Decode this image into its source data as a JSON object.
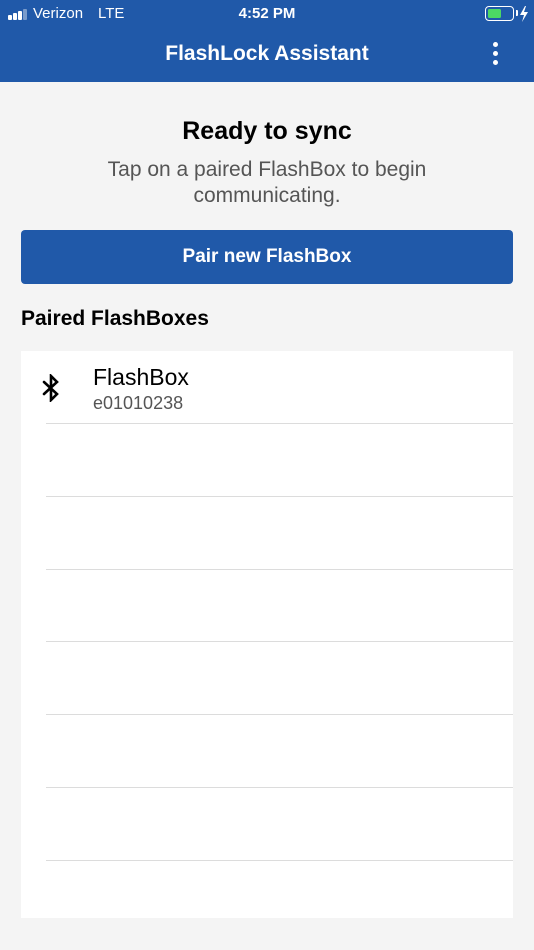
{
  "status_bar": {
    "carrier": "Verizon",
    "network": "LTE",
    "time": "4:52 PM",
    "signal_bars_filled": 3,
    "signal_bars_total": 4,
    "battery_level": 0.6,
    "battery_color": "#4cd964",
    "charging": true,
    "icons": [
      "signal-bars-icon",
      "battery-icon",
      "charging-bolt-icon"
    ]
  },
  "app_bar": {
    "title": "FlashLock Assistant",
    "menu_icon": "more-vertical-icon",
    "background": "#2059a9"
  },
  "intro": {
    "title": "Ready to sync",
    "subtitle": "Tap on a paired FlashBox to begin communicating."
  },
  "pair_button": {
    "label": "Pair new FlashBox",
    "background": "#2059a9"
  },
  "paired_section": {
    "title": "Paired FlashBoxes",
    "devices": [
      {
        "name": "FlashBox",
        "id": "e01010238",
        "icon": "bluetooth-icon"
      }
    ],
    "empty_rows": 7
  }
}
